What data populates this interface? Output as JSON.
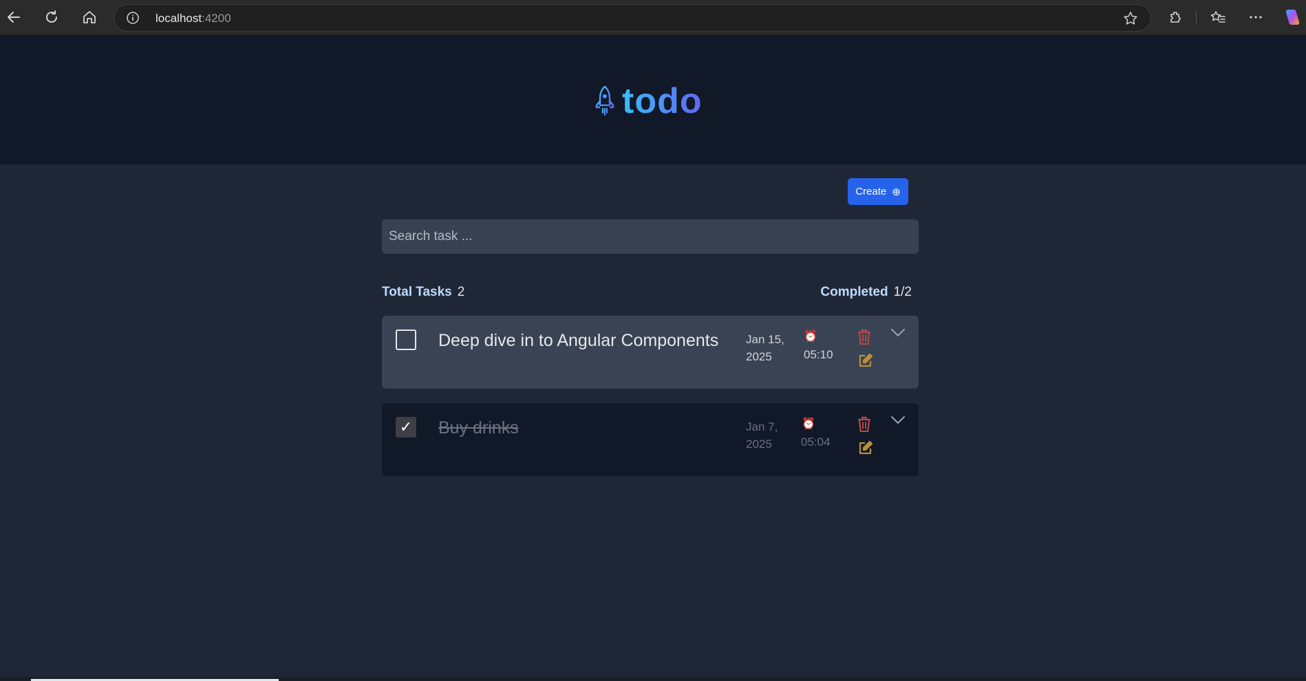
{
  "browser": {
    "url_host": "localhost",
    "url_port": ":4200"
  },
  "app": {
    "title": "todo"
  },
  "toolbar": {
    "create_label": "Create",
    "create_icon": "⊕"
  },
  "search": {
    "placeholder": "Search task ..."
  },
  "stats": {
    "total_label": "Total Tasks",
    "total_value": "2",
    "completed_label": "Completed",
    "completed_value": "1/2"
  },
  "tasks": [
    {
      "title": "Deep dive in to Angular Components",
      "date": "Jan 15, 2025",
      "time": "05:10",
      "alarm_icon": "⏰",
      "completed": false
    },
    {
      "title": "Buy drinks",
      "date": "Jan 7, 2025",
      "time": "05:04",
      "alarm_icon": "⏰",
      "check_mark": "✓",
      "completed": true
    }
  ],
  "colors": {
    "accent": "#2563eb",
    "delete": "#b24a4a",
    "edit": "#b8903a",
    "header_bg": "#111827",
    "page_bg": "#1f2737"
  }
}
